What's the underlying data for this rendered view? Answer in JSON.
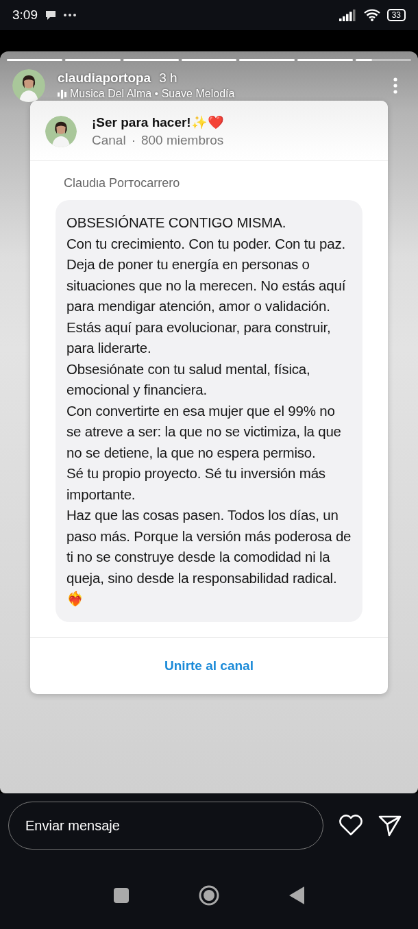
{
  "status_bar": {
    "time": "3:09",
    "battery": "33"
  },
  "story": {
    "progress": [
      {
        "level": 1
      },
      {
        "level": 1
      },
      {
        "level": 1
      },
      {
        "level": 1
      },
      {
        "level": 1
      },
      {
        "level": 1
      },
      {
        "level": 0.3
      }
    ],
    "user": "claudiaportopa",
    "age": "3 h",
    "music": "Musica Del Alma • Suave Melodía"
  },
  "card": {
    "channel_name": "¡Ser para hacer!✨❤️",
    "channel_type": "Canal",
    "separator": "·",
    "members": "800 miembros",
    "sender": "Claudιa  Porтocarrero",
    "message": [
      "OBSESIÓNATE CONTIGO MISMA.",
      "Con tu crecimiento. Con tu poder. Con tu paz.",
      "Deja de poner tu energía en personas o situaciones que no la merecen. No estás aquí para mendigar atención, amor o validación. Estás aquí para evolucionar, para construir, para liderarte.",
      "Obsesiónate con tu salud mental, física, emocional y financiera.",
      "Con convertirte en esa mujer que el 99% no se atreve a ser: la que no se victimiza, la que no se detiene, la que no espera permiso.",
      "Sé tu propio proyecto. Sé tu inversión más importante.",
      "Haz que las cosas pasen. Todos los días, un paso más. Porque la versión más poderosa de ti no se construye desde la comodidad ni la queja, sino desde la responsabilidad radical.❤️‍🔥"
    ],
    "join_button": "Unirte al canal"
  },
  "reply": {
    "placeholder": "Enviar mensaje"
  }
}
